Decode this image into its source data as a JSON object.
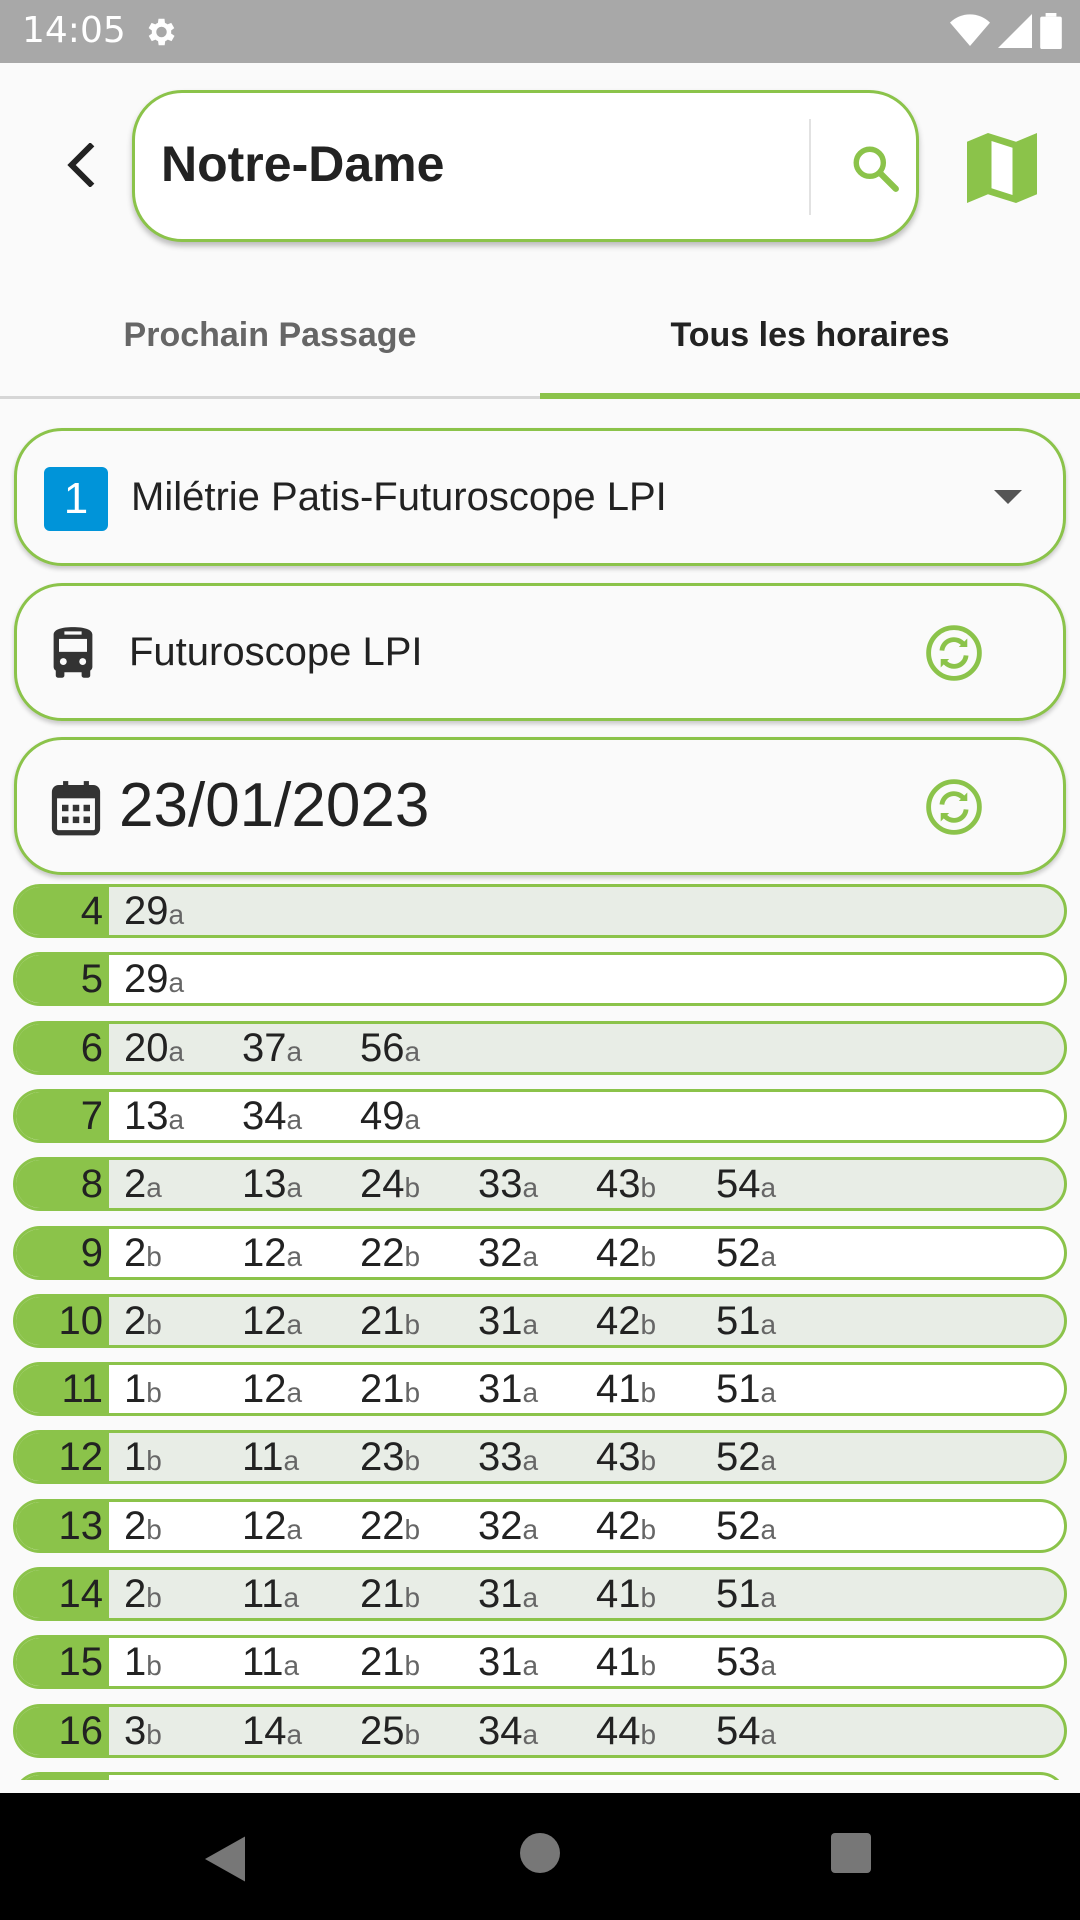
{
  "status_bar": {
    "time": "14:05"
  },
  "header": {
    "search_value": "Notre-Dame"
  },
  "tabs": [
    {
      "label": "Prochain Passage",
      "active": false
    },
    {
      "label": "Tous les horaires",
      "active": true
    }
  ],
  "line_selector": {
    "badge": "1",
    "badge_color": "#0094d9",
    "name": "Milétrie Patis-Futuroscope LPI"
  },
  "direction": {
    "name": "Futuroscope LPI"
  },
  "date": {
    "value": "23/01/2023"
  },
  "colors": {
    "accent": "#8bc34a",
    "row_shaded": "#e8ede6"
  },
  "timetable": [
    {
      "hour": "4",
      "times": [
        {
          "m": "29",
          "s": "a"
        }
      ]
    },
    {
      "hour": "5",
      "times": [
        {
          "m": "29",
          "s": "a"
        }
      ]
    },
    {
      "hour": "6",
      "times": [
        {
          "m": "20",
          "s": "a"
        },
        {
          "m": "37",
          "s": "a"
        },
        {
          "m": "56",
          "s": "a"
        }
      ]
    },
    {
      "hour": "7",
      "times": [
        {
          "m": "13",
          "s": "a"
        },
        {
          "m": "34",
          "s": "a"
        },
        {
          "m": "49",
          "s": "a"
        }
      ]
    },
    {
      "hour": "8",
      "times": [
        {
          "m": "2",
          "s": "a"
        },
        {
          "m": "13",
          "s": "a"
        },
        {
          "m": "24",
          "s": "b"
        },
        {
          "m": "33",
          "s": "a"
        },
        {
          "m": "43",
          "s": "b"
        },
        {
          "m": "54",
          "s": "a"
        }
      ]
    },
    {
      "hour": "9",
      "times": [
        {
          "m": "2",
          "s": "b"
        },
        {
          "m": "12",
          "s": "a"
        },
        {
          "m": "22",
          "s": "b"
        },
        {
          "m": "32",
          "s": "a"
        },
        {
          "m": "42",
          "s": "b"
        },
        {
          "m": "52",
          "s": "a"
        }
      ]
    },
    {
      "hour": "10",
      "times": [
        {
          "m": "2",
          "s": "b"
        },
        {
          "m": "12",
          "s": "a"
        },
        {
          "m": "21",
          "s": "b"
        },
        {
          "m": "31",
          "s": "a"
        },
        {
          "m": "42",
          "s": "b"
        },
        {
          "m": "51",
          "s": "a"
        }
      ]
    },
    {
      "hour": "11",
      "times": [
        {
          "m": "1",
          "s": "b"
        },
        {
          "m": "12",
          "s": "a"
        },
        {
          "m": "21",
          "s": "b"
        },
        {
          "m": "31",
          "s": "a"
        },
        {
          "m": "41",
          "s": "b"
        },
        {
          "m": "51",
          "s": "a"
        }
      ]
    },
    {
      "hour": "12",
      "times": [
        {
          "m": "1",
          "s": "b"
        },
        {
          "m": "11",
          "s": "a"
        },
        {
          "m": "23",
          "s": "b"
        },
        {
          "m": "33",
          "s": "a"
        },
        {
          "m": "43",
          "s": "b"
        },
        {
          "m": "52",
          "s": "a"
        }
      ]
    },
    {
      "hour": "13",
      "times": [
        {
          "m": "2",
          "s": "b"
        },
        {
          "m": "12",
          "s": "a"
        },
        {
          "m": "22",
          "s": "b"
        },
        {
          "m": "32",
          "s": "a"
        },
        {
          "m": "42",
          "s": "b"
        },
        {
          "m": "52",
          "s": "a"
        }
      ]
    },
    {
      "hour": "14",
      "times": [
        {
          "m": "2",
          "s": "b"
        },
        {
          "m": "11",
          "s": "a"
        },
        {
          "m": "21",
          "s": "b"
        },
        {
          "m": "31",
          "s": "a"
        },
        {
          "m": "41",
          "s": "b"
        },
        {
          "m": "51",
          "s": "a"
        }
      ]
    },
    {
      "hour": "15",
      "times": [
        {
          "m": "1",
          "s": "b"
        },
        {
          "m": "11",
          "s": "a"
        },
        {
          "m": "21",
          "s": "b"
        },
        {
          "m": "31",
          "s": "a"
        },
        {
          "m": "41",
          "s": "b"
        },
        {
          "m": "53",
          "s": "a"
        }
      ]
    },
    {
      "hour": "16",
      "times": [
        {
          "m": "3",
          "s": "b"
        },
        {
          "m": "14",
          "s": "a"
        },
        {
          "m": "25",
          "s": "b"
        },
        {
          "m": "34",
          "s": "a"
        },
        {
          "m": "44",
          "s": "b"
        },
        {
          "m": "54",
          "s": "a"
        }
      ]
    }
  ]
}
